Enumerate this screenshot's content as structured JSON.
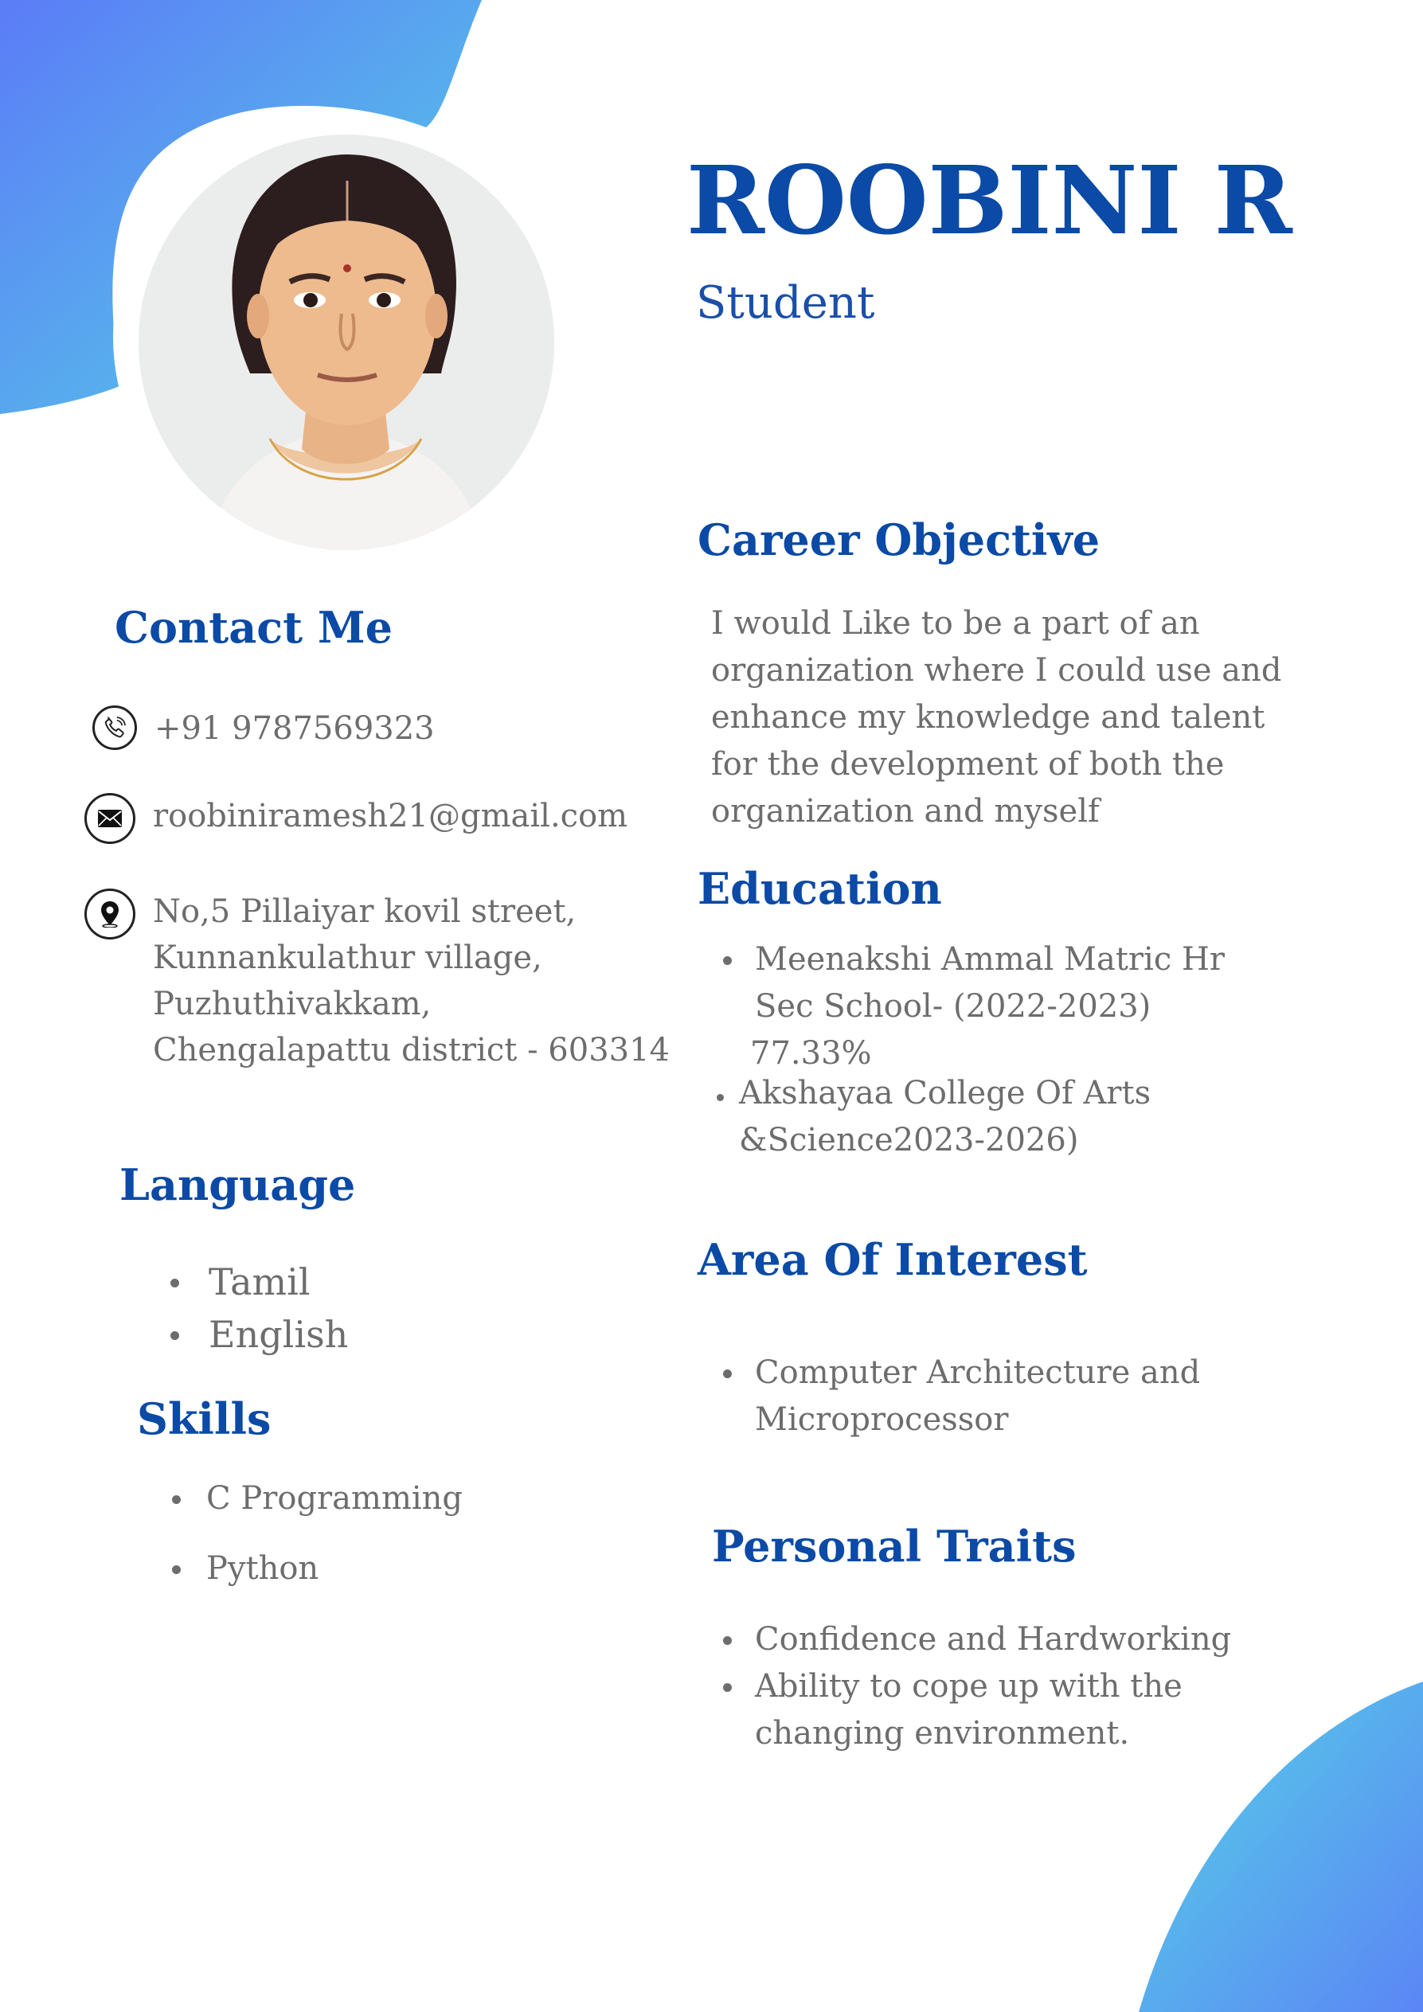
{
  "header": {
    "name": "ROOBINI R",
    "role": "Student"
  },
  "colors": {
    "heading": "#0b4aa6",
    "body_text": "#6d6d6d",
    "blob_start": "#5b7cf7",
    "blob_end": "#56d2e6"
  },
  "contact": {
    "heading": "Contact Me",
    "phone": "+91 9787569323",
    "email": "roobiniramesh21@gmail.com",
    "address_lines": [
      "No,5 Pillaiyar kovil street,",
      "Kunnankulathur village,",
      "Puzhuthivakkam,",
      "Chengalapattu district - 603314"
    ],
    "icons": [
      "phone-icon",
      "mail-icon",
      "location-pin-icon"
    ]
  },
  "language": {
    "heading": "Language",
    "items": [
      "Tamil",
      "English"
    ]
  },
  "skills": {
    "heading": "Skills",
    "items": [
      "C Programming",
      "Python"
    ]
  },
  "career_objective": {
    "heading": "Career Objective",
    "lines": [
      "I would Like to be a part of an",
      "organization where I could use and",
      "enhance my knowledge and talent",
      "for the development of both the",
      "organization and myself"
    ]
  },
  "education": {
    "heading": "Education",
    "items": [
      {
        "lines": [
          "Meenakshi Ammal Matric Hr",
          "Sec School- (2022-2023)",
          "77.33%"
        ]
      },
      {
        "lines": [
          "Akshayaa College Of Arts",
          "&Science2023-2026)"
        ]
      }
    ]
  },
  "area_of_interest": {
    "heading": "Area Of Interest",
    "items": [
      {
        "lines": [
          "Computer Architecture and",
          "Microprocessor"
        ]
      }
    ]
  },
  "personal_traits": {
    "heading": "Personal Traits",
    "items": [
      {
        "lines": [
          "Confidence and Hardworking"
        ]
      },
      {
        "lines": [
          "Ability to cope up with the",
          "changing environment."
        ]
      }
    ]
  }
}
